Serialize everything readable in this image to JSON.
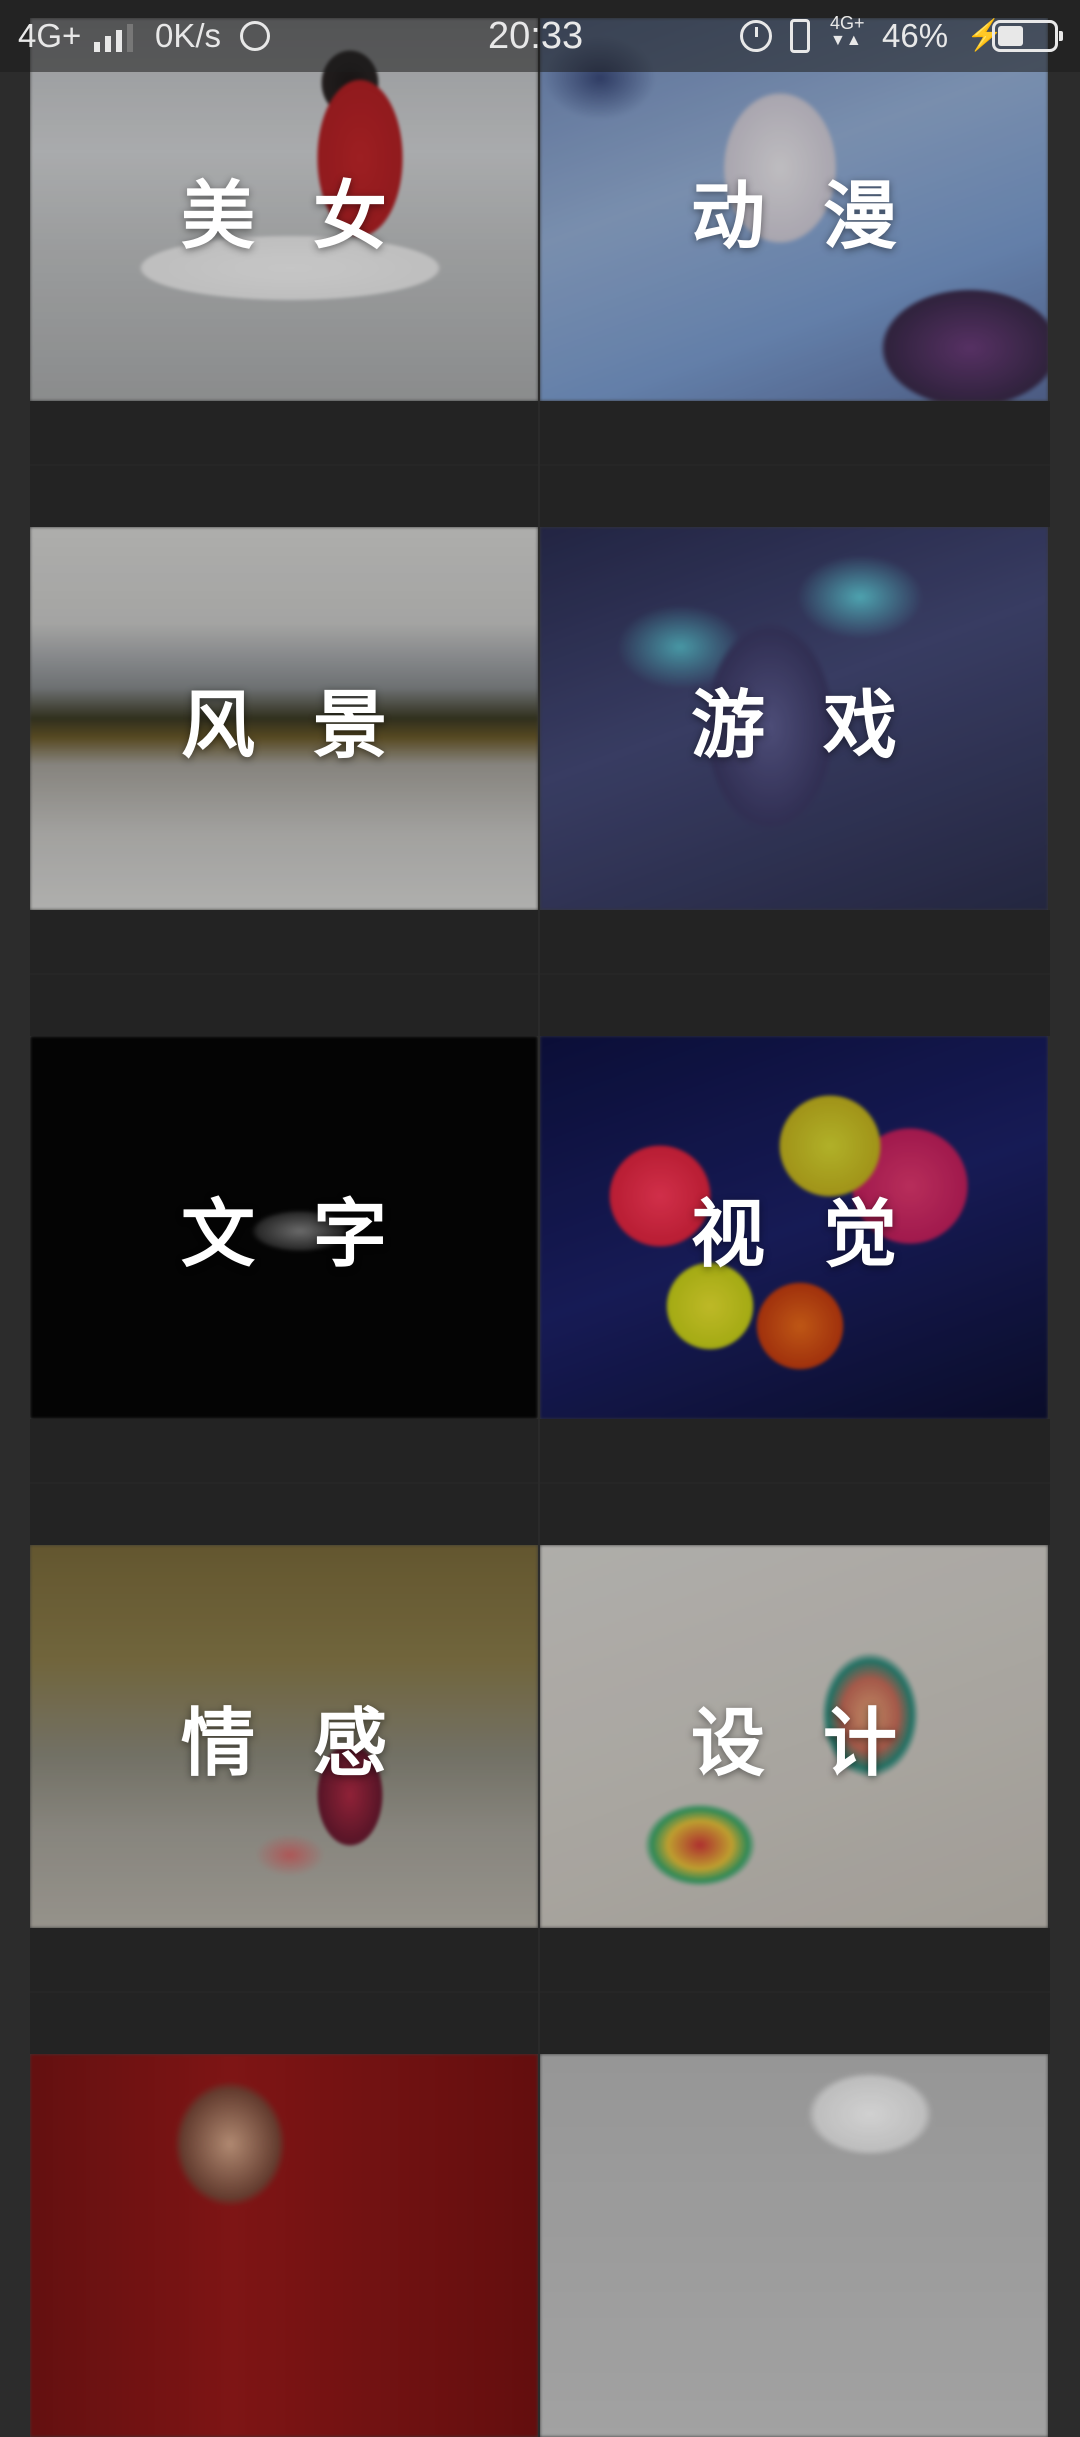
{
  "status_bar": {
    "network": "4G+",
    "speed": "0K/s",
    "time": "20:33",
    "secondary_network": "4G+",
    "battery_percent": "46%",
    "battery_level": 0.46,
    "icons": [
      "signal-icon",
      "weibo-icon",
      "alarm-icon",
      "vibrate-icon",
      "charging-icon",
      "battery-icon"
    ]
  },
  "categories": [
    {
      "label": "美女"
    },
    {
      "label": "动漫"
    },
    {
      "label": "风景"
    },
    {
      "label": "游戏"
    },
    {
      "label": "文字"
    },
    {
      "label": "视觉"
    },
    {
      "label": "情感"
    },
    {
      "label": "设计"
    }
  ]
}
